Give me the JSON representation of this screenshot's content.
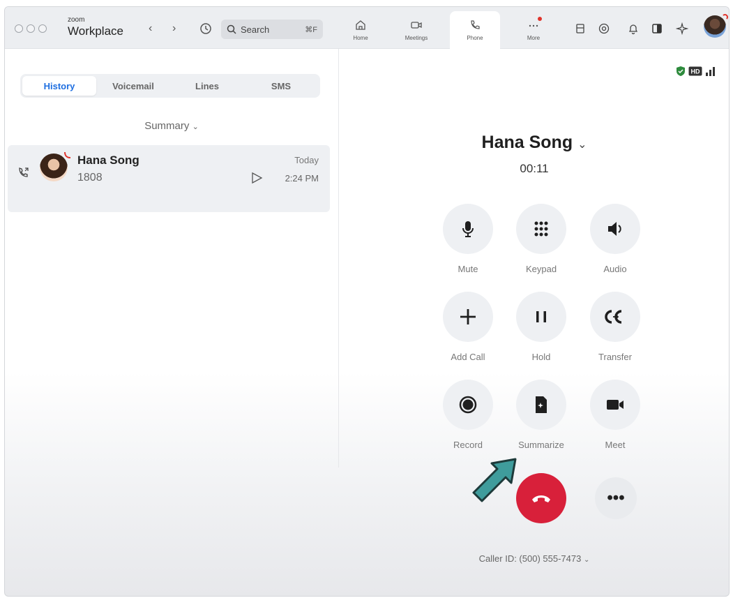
{
  "app": {
    "brand_small": "zoom",
    "brand_big": "Workplace"
  },
  "search": {
    "placeholder": "Search",
    "shortcut": "⌘F"
  },
  "nav": {
    "tabs": [
      {
        "label": "Home",
        "icon": "home-icon"
      },
      {
        "label": "Meetings",
        "icon": "video-icon"
      },
      {
        "label": "Phone",
        "icon": "phone-icon",
        "active": true
      },
      {
        "label": "More",
        "icon": "more-icon"
      }
    ]
  },
  "toolbar_icons": [
    "inbox-icon",
    "help-icon",
    "bell-icon",
    "panel-icon",
    "sparkle-icon"
  ],
  "left": {
    "tabs": [
      "History",
      "Voicemail",
      "Lines",
      "SMS"
    ],
    "active_tab": "History",
    "filter_label": "Summary",
    "history": [
      {
        "name": "Hana Song",
        "ext": "1808",
        "date": "Today",
        "time": "2:24 PM"
      }
    ]
  },
  "call": {
    "name": "Hana Song",
    "timer": "00:11",
    "controls": [
      {
        "label": "Mute",
        "icon": "microphone-icon"
      },
      {
        "label": "Keypad",
        "icon": "keypad-icon"
      },
      {
        "label": "Audio",
        "icon": "speaker-icon"
      },
      {
        "label": "Add Call",
        "icon": "plus-icon"
      },
      {
        "label": "Hold",
        "icon": "pause-icon"
      },
      {
        "label": "Transfer",
        "icon": "transfer-icon"
      },
      {
        "label": "Record",
        "icon": "record-icon"
      },
      {
        "label": "Summarize",
        "icon": "summarize-icon"
      },
      {
        "label": "Meet",
        "icon": "video-camera-icon"
      }
    ],
    "more_label": "•••",
    "caller_id": "Caller ID: (500) 555-7473"
  },
  "colors": {
    "accent_blue": "#1f6fe0",
    "end_call_red": "#d8203a",
    "arrow_teal": "#3f9c9c",
    "shield_green": "#2e8b3d"
  }
}
